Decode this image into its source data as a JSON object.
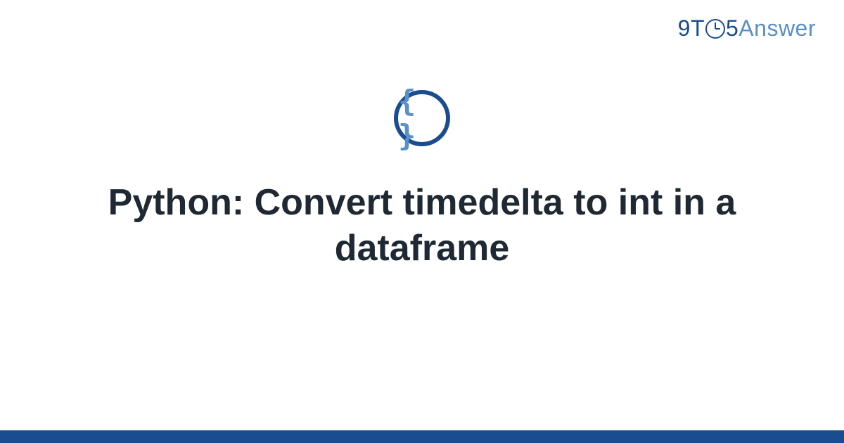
{
  "logo": {
    "part1": "9T",
    "part2": "5",
    "part3": "Answer"
  },
  "icon": {
    "braces": "{ }"
  },
  "title": "Python: Convert timedelta to int in a dataframe"
}
